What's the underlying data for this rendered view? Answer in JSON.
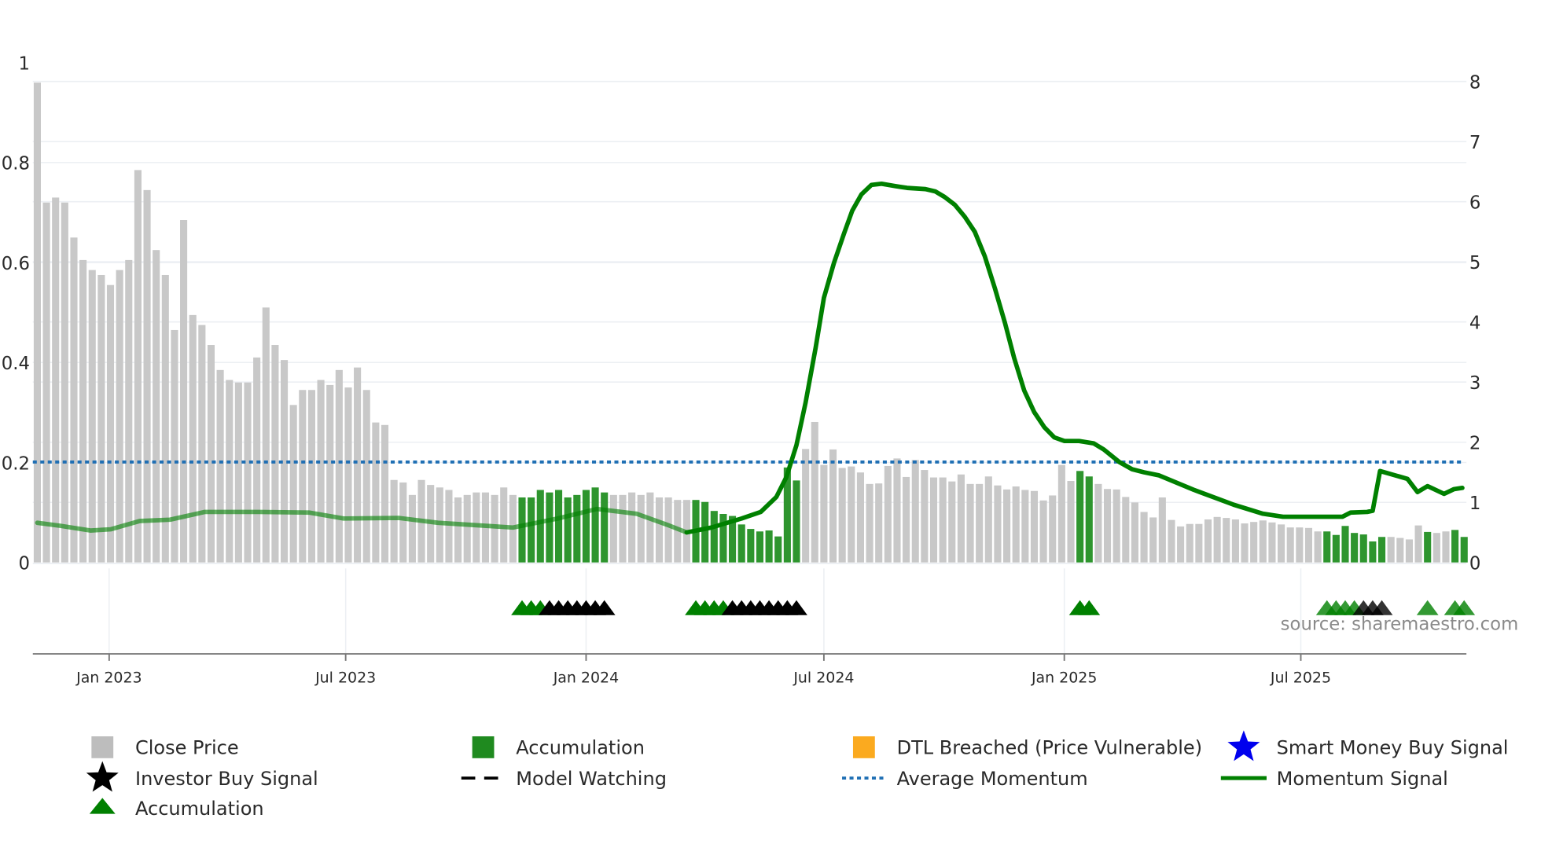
{
  "chart_data": {
    "type": "bar",
    "title": "",
    "x_start": "2022-11-07",
    "x_step_days": 7,
    "x_ticks": [
      {
        "label": "Jan 2023",
        "date": "2023-01-01"
      },
      {
        "label": "Jul 2023",
        "date": "2023-07-01"
      },
      {
        "label": "Jan 2024",
        "date": "2024-01-01"
      },
      {
        "label": "Jul 2024",
        "date": "2024-07-01"
      },
      {
        "label": "Jan 2025",
        "date": "2025-01-01"
      },
      {
        "label": "Jul 2025",
        "date": "2025-07-01"
      }
    ],
    "y_left": {
      "ylim": [
        0,
        1
      ],
      "ticks": [
        "0",
        "0.2",
        "0.4",
        "0.6",
        "0.8",
        "1"
      ],
      "tick_values": [
        0,
        0.2,
        0.4,
        0.6,
        0.8,
        1
      ]
    },
    "y_right": {
      "ylim": [
        0,
        8
      ],
      "ticks": [
        "0",
        "1",
        "2",
        "3",
        "4",
        "5",
        "6",
        "7",
        "8"
      ],
      "tick_values": [
        0,
        1,
        2,
        3,
        4,
        5,
        6,
        7,
        8
      ]
    },
    "grid": true,
    "close_price": [
      0.96,
      0.72,
      0.73,
      0.72,
      0.65,
      0.605,
      0.585,
      0.575,
      0.555,
      0.585,
      0.605,
      0.785,
      0.745,
      0.625,
      0.575,
      0.465,
      0.685,
      0.495,
      0.475,
      0.435,
      0.385,
      0.365,
      0.36,
      0.36,
      0.41,
      0.51,
      0.435,
      0.405,
      0.315,
      0.345,
      0.345,
      0.365,
      0.355,
      0.385,
      0.35,
      0.39,
      0.345,
      0.28,
      0.275,
      0.165,
      0.16,
      0.135,
      0.165,
      0.155,
      0.15,
      0.145,
      0.13,
      0.135,
      0.14,
      0.14,
      0.135,
      0.15,
      0.135,
      0.13,
      0.13,
      0.145,
      0.14,
      0.145,
      0.13,
      0.135,
      0.145,
      0.15,
      0.14,
      0.135,
      0.135,
      0.14,
      0.135,
      0.14,
      0.13,
      0.13,
      0.125,
      0.125,
      0.125,
      0.121,
      0.103,
      0.097,
      0.093,
      0.076,
      0.067,
      0.062,
      0.064,
      0.052,
      0.19,
      0.164,
      0.227,
      0.281,
      0.195,
      0.226,
      0.189,
      0.192,
      0.18,
      0.157,
      0.158,
      0.193,
      0.208,
      0.171,
      0.205,
      0.185,
      0.17,
      0.17,
      0.162,
      0.176,
      0.157,
      0.157,
      0.172,
      0.154,
      0.146,
      0.152,
      0.145,
      0.143,
      0.124,
      0.134,
      0.195,
      0.163,
      0.183,
      0.172,
      0.157,
      0.147,
      0.146,
      0.131,
      0.12,
      0.101,
      0.09,
      0.13,
      0.085,
      0.072,
      0.077,
      0.077,
      0.086,
      0.091,
      0.089,
      0.086,
      0.078,
      0.081,
      0.084,
      0.08,
      0.076,
      0.07,
      0.07,
      0.069,
      0.062,
      0.062,
      0.055,
      0.073,
      0.059,
      0.056,
      0.042,
      0.051,
      0.051,
      0.049,
      0.046,
      0.074,
      0.061,
      0.059,
      0.062,
      0.065,
      0.051
    ],
    "accumulation_weeks": [
      53,
      54,
      55,
      56,
      57,
      58,
      59,
      60,
      61,
      62,
      72,
      73,
      74,
      75,
      76,
      77,
      78,
      79,
      80,
      81,
      82,
      83,
      114,
      115,
      141,
      142,
      143,
      144,
      145,
      146,
      147,
      152,
      155,
      156
    ],
    "momentum": [
      [
        0,
        0.66
      ],
      [
        2.5,
        0.61
      ],
      [
        5.8,
        0.53
      ],
      [
        8,
        0.55
      ],
      [
        11.2,
        0.69
      ],
      [
        14.5,
        0.71
      ],
      [
        18.3,
        0.84
      ],
      [
        24.2,
        0.84
      ],
      [
        29.7,
        0.83
      ],
      [
        33.5,
        0.73
      ],
      [
        39.5,
        0.74
      ],
      [
        43.8,
        0.66
      ],
      [
        52,
        0.58
      ],
      [
        56.9,
        0.73
      ],
      [
        61.2,
        0.89
      ],
      [
        65.5,
        0.81
      ],
      [
        68.8,
        0.63
      ],
      [
        71,
        0.5
      ],
      [
        73.7,
        0.58
      ],
      [
        77,
        0.73
      ],
      [
        79.1,
        0.84
      ],
      [
        80.8,
        1.09
      ],
      [
        81.9,
        1.42
      ],
      [
        83,
        1.95
      ],
      [
        84,
        2.66
      ],
      [
        85.1,
        3.57
      ],
      [
        86,
        4.4
      ],
      [
        87.1,
        4.98
      ],
      [
        88.2,
        5.47
      ],
      [
        89.1,
        5.85
      ],
      [
        90.1,
        6.12
      ],
      [
        91.2,
        6.28
      ],
      [
        92.3,
        6.3
      ],
      [
        93.8,
        6.26
      ],
      [
        95.1,
        6.23
      ],
      [
        97.1,
        6.21
      ],
      [
        98.2,
        6.17
      ],
      [
        99.2,
        6.08
      ],
      [
        100.3,
        5.95
      ],
      [
        101.4,
        5.75
      ],
      [
        102.5,
        5.5
      ],
      [
        103.6,
        5.09
      ],
      [
        104.7,
        4.56
      ],
      [
        105.8,
        3.98
      ],
      [
        106.8,
        3.4
      ],
      [
        107.9,
        2.86
      ],
      [
        109,
        2.5
      ],
      [
        110.1,
        2.25
      ],
      [
        111.2,
        2.08
      ],
      [
        112.3,
        2.02
      ],
      [
        113.9,
        2.02
      ],
      [
        115.5,
        1.98
      ],
      [
        116.6,
        1.88
      ],
      [
        118.3,
        1.67
      ],
      [
        119.7,
        1.55
      ],
      [
        121,
        1.5
      ],
      [
        122.6,
        1.45
      ],
      [
        126.4,
        1.21
      ],
      [
        130.8,
        0.96
      ],
      [
        134,
        0.81
      ],
      [
        136.2,
        0.76
      ],
      [
        142.7,
        0.76
      ],
      [
        143.6,
        0.83
      ],
      [
        145.4,
        0.84
      ],
      [
        146,
        0.86
      ],
      [
        146.8,
        1.52
      ],
      [
        149.8,
        1.39
      ],
      [
        150.9,
        1.17
      ],
      [
        152,
        1.27
      ],
      [
        153.8,
        1.14
      ],
      [
        154.9,
        1.22
      ],
      [
        155.8,
        1.24
      ]
    ],
    "momentum_emphasis_from_week": 71,
    "average_momentum": 1.67,
    "signal_markers": {
      "accumulation": [
        53,
        54,
        55,
        72,
        73,
        74,
        75,
        114,
        115,
        141,
        142,
        143,
        144,
        152,
        155,
        156
      ],
      "investor_buy": [
        56,
        57,
        58,
        59,
        60,
        61,
        62,
        76,
        77,
        78,
        79,
        80,
        81,
        82,
        83,
        145,
        146,
        147
      ]
    },
    "legend": [
      {
        "label": "Close Price",
        "marker": "square",
        "color": "#bdbdbd"
      },
      {
        "label": "Accumulation",
        "marker": "square",
        "color": "#1f8a1f"
      },
      {
        "label": "DTL Breached (Price Vulnerable)",
        "marker": "square",
        "color": "#fbaa1f"
      },
      {
        "label": "Smart Money Buy Signal",
        "marker": "star",
        "color": "#0000ee"
      },
      {
        "label": "Investor Buy Signal",
        "marker": "star",
        "color": "#000000"
      },
      {
        "label": "Model Watching",
        "marker": "dashed-line",
        "color": "#000000"
      },
      {
        "label": "Average Momentum",
        "marker": "dotted-line",
        "color": "#1f6fb4"
      },
      {
        "label": "Momentum Signal",
        "marker": "line",
        "color": "#008000"
      },
      {
        "label": "Accumulation",
        "marker": "triangle",
        "color": "#008000"
      }
    ],
    "legend_placement": "bottom",
    "annotation": "source: sharemaestro.com",
    "colors": {
      "close": "#c8c8c8",
      "accum_bar": "#2e952e",
      "momentum": "#008000",
      "avg": "#1f6fb4",
      "grid": "#eceff3",
      "axis": "#777777"
    }
  }
}
